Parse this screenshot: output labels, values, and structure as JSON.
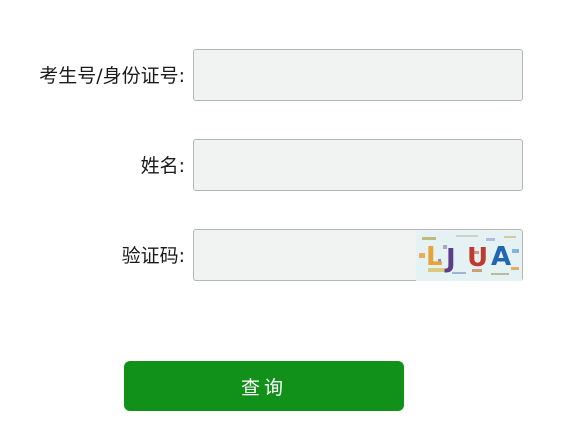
{
  "form": {
    "id_field": {
      "label": "考生号/身份证号:",
      "value": "",
      "placeholder": ""
    },
    "name_field": {
      "label": "姓名:",
      "value": "",
      "placeholder": ""
    },
    "captcha_field": {
      "label": "验证码:",
      "value": "",
      "placeholder": "",
      "image_text": "LJUA"
    },
    "submit_label": "查询"
  },
  "colors": {
    "button_bg": "#11911a",
    "input_bg": "#f1f3f3",
    "input_border": "#b5b5b5"
  }
}
